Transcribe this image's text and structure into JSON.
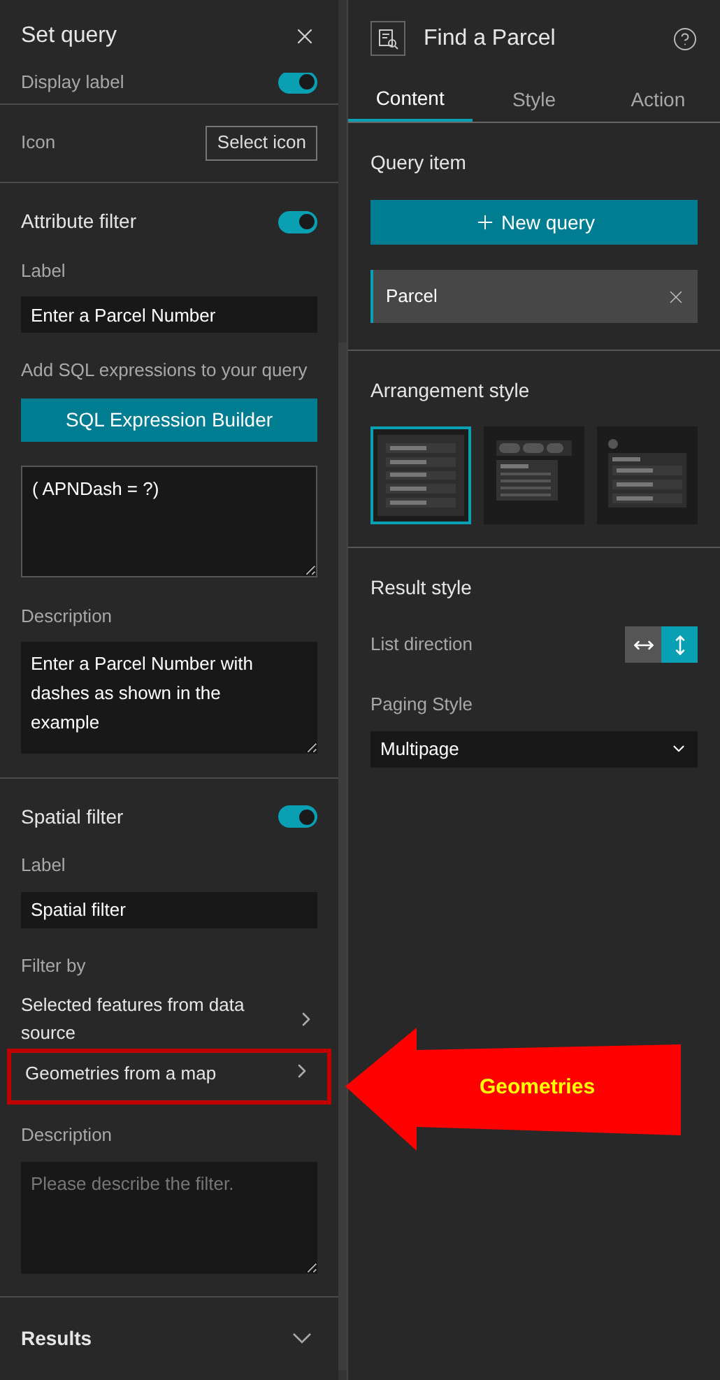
{
  "left_panel": {
    "title": "Set query",
    "display_label": {
      "label": "Display label",
      "on": true
    },
    "icon_row": {
      "label": "Icon",
      "button": "Select icon"
    },
    "attribute_filter": {
      "title": "Attribute filter",
      "on": true,
      "label_caption": "Label",
      "label_value": "Enter a Parcel Number",
      "sql_caption": "Add SQL expressions to your query",
      "sql_button": "SQL Expression Builder",
      "sql_value": "( APNDash = ?)",
      "description_caption": "Description",
      "description_value": "Enter a Parcel Number with dashes as shown in the example"
    },
    "spatial_filter": {
      "title": "Spatial filter",
      "on": true,
      "label_caption": "Label",
      "label_value": "Spatial filter",
      "filter_by_caption": "Filter by",
      "filter_options": [
        {
          "label": "Selected features from data source",
          "highlighted": false
        },
        {
          "label": "Geometries from a map",
          "highlighted": true
        }
      ],
      "description_caption": "Description",
      "description_placeholder": "Please describe the filter."
    },
    "results": {
      "title": "Results",
      "expanded": false
    }
  },
  "right_panel": {
    "title": "Find a Parcel",
    "tabs": [
      {
        "label": "Content",
        "selected": true
      },
      {
        "label": "Style",
        "selected": false
      },
      {
        "label": "Action",
        "selected": false
      }
    ],
    "query_item": {
      "title": "Query item",
      "new_button": "New query",
      "items": [
        {
          "label": "Parcel",
          "selected": true
        }
      ]
    },
    "arrangement": {
      "title": "Arrangement style",
      "options": [
        {
          "kind": "list",
          "selected": true
        },
        {
          "kind": "popper",
          "selected": false
        },
        {
          "kind": "panel",
          "selected": false
        }
      ]
    },
    "result_style": {
      "title": "Result style",
      "list_direction_label": "List direction",
      "directions": [
        {
          "kind": "horizontal",
          "selected": false
        },
        {
          "kind": "vertical",
          "selected": true
        }
      ],
      "paging_label": "Paging Style",
      "paging_value": "Multipage"
    }
  },
  "annotation": {
    "label": "Geometries"
  }
}
